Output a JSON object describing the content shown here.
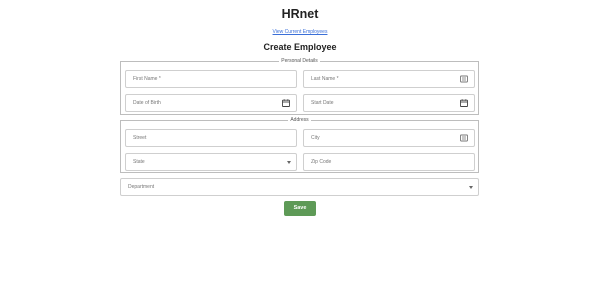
{
  "app": {
    "title": "HRnet"
  },
  "nav": {
    "view_employees_link": "View Current Employees"
  },
  "form": {
    "title": "Create Employee",
    "personal": {
      "legend": "Personal Details",
      "first_name_placeholder": "First Name *",
      "last_name_placeholder": "Last Name *",
      "dob_placeholder": "Date of Birth",
      "start_date_placeholder": "Start Date"
    },
    "address": {
      "legend": "Address",
      "street_placeholder": "Street",
      "city_placeholder": "City",
      "state_placeholder": "State",
      "zip_placeholder": "Zip Code"
    },
    "department_placeholder": "Department",
    "save_label": "Save"
  },
  "colors": {
    "save_button": "#5e9a57",
    "link": "#3a6fd8",
    "border": "#bdbdbd"
  }
}
